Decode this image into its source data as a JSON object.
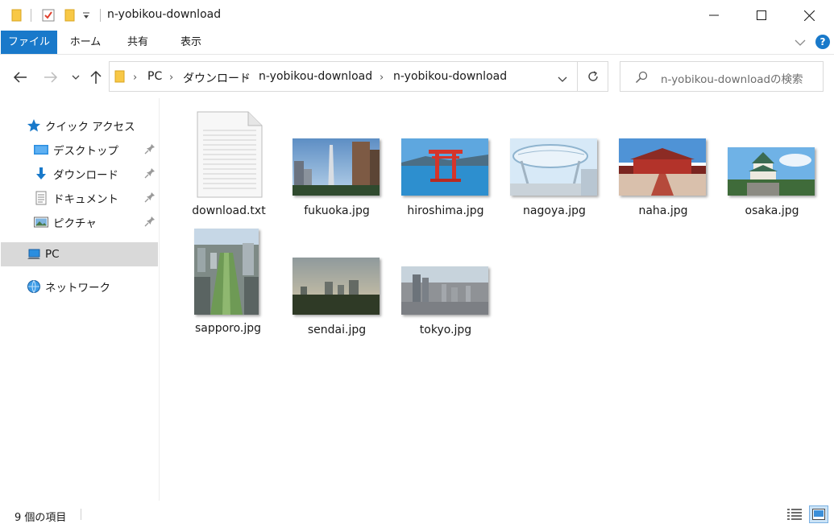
{
  "window": {
    "title": "n-yobikou-download",
    "controls": {
      "minimize": "—",
      "maximize": "☐",
      "close": "✕"
    }
  },
  "ribbon": {
    "tabs": [
      "ファイル",
      "ホーム",
      "共有",
      "表示"
    ],
    "help": "?"
  },
  "address": {
    "crumbs": [
      "PC",
      "ダウンロード",
      "n-yobikou-download",
      "n-yobikou-download"
    ]
  },
  "search": {
    "placeholder": "n-yobikou-downloadの検索"
  },
  "sidebar": {
    "items": [
      {
        "label": "クイック アクセス",
        "icon": "star-icon"
      },
      {
        "label": "デスクトップ",
        "icon": "desktop-icon",
        "pinned": true
      },
      {
        "label": "ダウンロード",
        "icon": "download-arrow-icon",
        "pinned": true
      },
      {
        "label": "ドキュメント",
        "icon": "document-icon",
        "pinned": true
      },
      {
        "label": "ピクチャ",
        "icon": "picture-icon",
        "pinned": true
      },
      {
        "label": "PC",
        "icon": "pc-icon",
        "selected": true
      },
      {
        "label": "ネットワーク",
        "icon": "network-icon"
      }
    ]
  },
  "files": [
    {
      "name": "download.txt",
      "kind": "text"
    },
    {
      "name": "fukuoka.jpg",
      "kind": "image"
    },
    {
      "name": "hiroshima.jpg",
      "kind": "image"
    },
    {
      "name": "nagoya.jpg",
      "kind": "image"
    },
    {
      "name": "naha.jpg",
      "kind": "image"
    },
    {
      "name": "osaka.jpg",
      "kind": "image"
    },
    {
      "name": "sapporo.jpg",
      "kind": "image"
    },
    {
      "name": "sendai.jpg",
      "kind": "image"
    },
    {
      "name": "tokyo.jpg",
      "kind": "image"
    }
  ],
  "status": {
    "item_count": "9 個の項目"
  },
  "colors": {
    "accent": "#1979ca",
    "selected_bg": "#d9d9d9",
    "folder": "#f8c846"
  }
}
